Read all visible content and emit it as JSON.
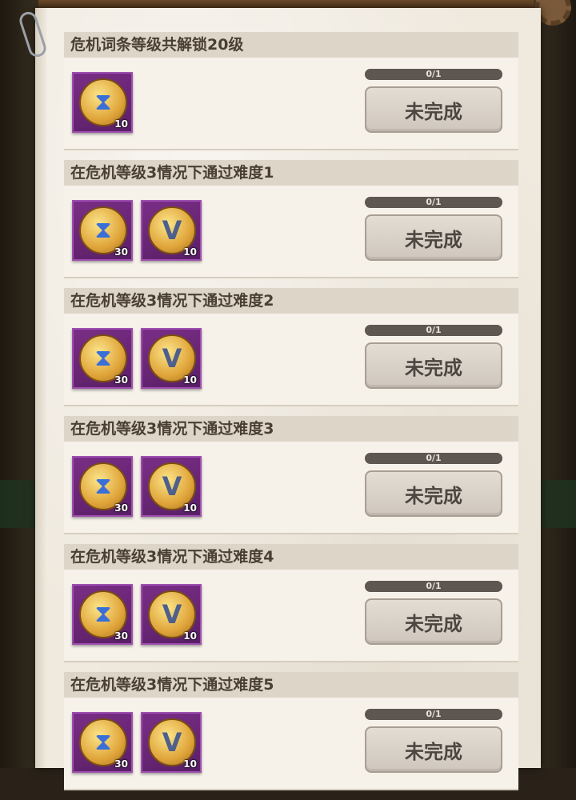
{
  "tasks": [
    {
      "title": "危机词条等级共解锁20级",
      "progress_text": "0/1",
      "progress": 0,
      "status": "未完成",
      "rewards": [
        {
          "icon": "hourglass-coin-icon",
          "count": "10"
        }
      ]
    },
    {
      "title": "在危机等级3情况下通过难度1",
      "progress_text": "0/1",
      "progress": 0,
      "status": "未完成",
      "rewards": [
        {
          "icon": "hourglass-coin-icon",
          "count": "30"
        },
        {
          "icon": "v-emblem-coin-icon",
          "count": "10"
        }
      ]
    },
    {
      "title": "在危机等级3情况下通过难度2",
      "progress_text": "0/1",
      "progress": 0,
      "status": "未完成",
      "rewards": [
        {
          "icon": "hourglass-coin-icon",
          "count": "30"
        },
        {
          "icon": "v-emblem-coin-icon",
          "count": "10"
        }
      ]
    },
    {
      "title": "在危机等级3情况下通过难度3",
      "progress_text": "0/1",
      "progress": 0,
      "status": "未完成",
      "rewards": [
        {
          "icon": "hourglass-coin-icon",
          "count": "30"
        },
        {
          "icon": "v-emblem-coin-icon",
          "count": "10"
        }
      ]
    },
    {
      "title": "在危机等级3情况下通过难度4",
      "progress_text": "0/1",
      "progress": 0,
      "status": "未完成",
      "rewards": [
        {
          "icon": "hourglass-coin-icon",
          "count": "30"
        },
        {
          "icon": "v-emblem-coin-icon",
          "count": "10"
        }
      ]
    },
    {
      "title": "在危机等级3情况下通过难度5",
      "progress_text": "0/1",
      "progress": 0,
      "status": "未完成",
      "rewards": [
        {
          "icon": "hourglass-coin-icon",
          "count": "30"
        },
        {
          "icon": "v-emblem-coin-icon",
          "count": "10"
        }
      ]
    }
  ],
  "colors": {
    "paper": "#efe9de",
    "header": "#ddd5c7",
    "reward_frame": "#7a2e86",
    "progress_track": "#5e5650",
    "button": "#d8d0c6"
  }
}
